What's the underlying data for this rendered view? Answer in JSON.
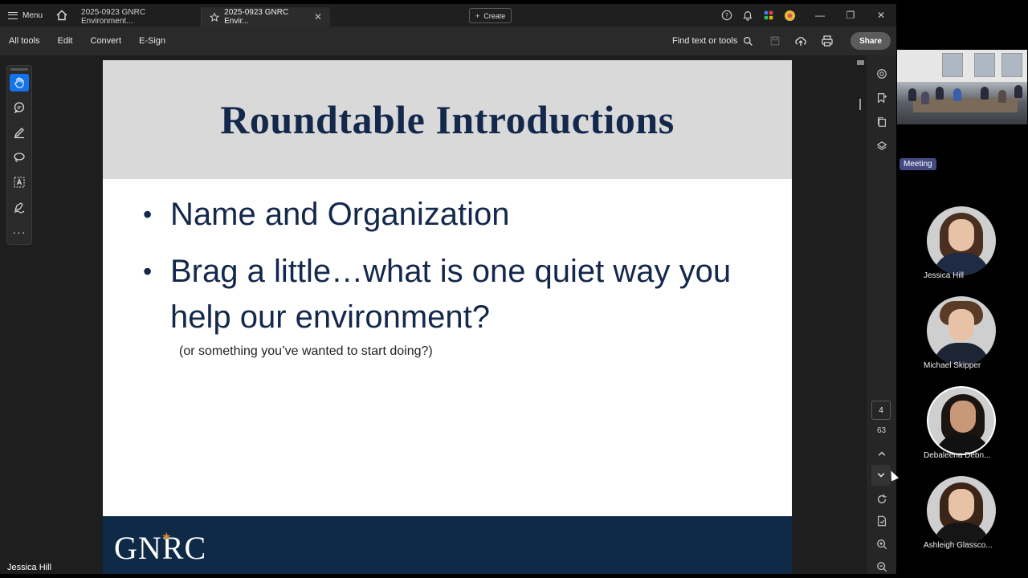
{
  "titlebar": {
    "menu_label": "Menu",
    "tabs": [
      {
        "label": "2025-0923 GNRC Environment..."
      },
      {
        "label": "2025-0923 GNRC Envir..."
      }
    ],
    "tab_close": "✕",
    "create_label": "Create",
    "window_controls": {
      "minimize": "—",
      "restore": "❐",
      "close": "✕"
    }
  },
  "toolbar": {
    "items": [
      "All tools",
      "Edit",
      "Convert",
      "E-Sign"
    ],
    "find_label": "Find text or tools",
    "share_label": "Share"
  },
  "slide": {
    "title": "Roundtable Introductions",
    "bullets": [
      "Name and Organization",
      "Brag a little…what is one quiet way you help our environment?"
    ],
    "sub_note": "(or something you’ve wanted to start doing?)",
    "logo_text": "GNRC"
  },
  "page_nav": {
    "current_page": "4",
    "total_pages": "63"
  },
  "teams": {
    "meeting_label": "Meeting",
    "participants": [
      {
        "name": "Jessica Hill"
      },
      {
        "name": "Michael Skipper"
      },
      {
        "name": "Debaleena Debn..."
      },
      {
        "name": "Ashleigh Glassco..."
      }
    ],
    "active_speaker": "Jessica Hill"
  },
  "colors": {
    "slide_title": "#14284b",
    "footer": "#0e2a47",
    "accent": "#1473e6",
    "logo_star": "#d38a2f"
  }
}
